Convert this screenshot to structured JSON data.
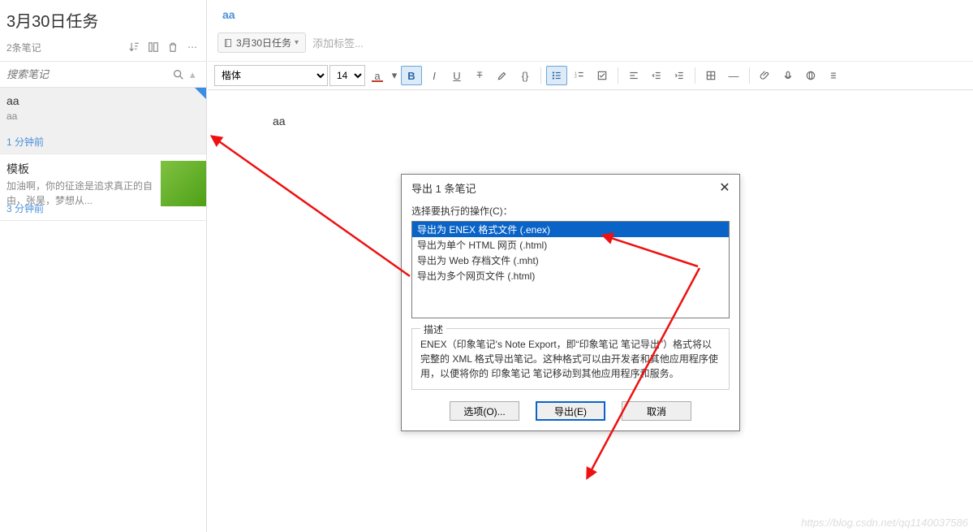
{
  "sidebar": {
    "title": "3月30日任务",
    "count_label": "2条笔记",
    "search_placeholder": "搜索笔记",
    "notes": [
      {
        "title": "aa",
        "preview": "aa",
        "time": "1 分钟前"
      },
      {
        "title": "模板",
        "preview": "加油啊，你的征途是追求真正的自由，张昊，梦想从...",
        "time": "3 分钟前"
      }
    ]
  },
  "main": {
    "title": "aa",
    "notebook_label": "3月30日任务",
    "tag_placeholder": "添加标签...",
    "font_name": "楷体",
    "font_size": "14",
    "body_text": "aa"
  },
  "dialog": {
    "title": "导出 1 条笔记",
    "select_label": "选择要执行的操作(C)：",
    "options": [
      "导出为 ENEX 格式文件 (.enex)",
      "导出为单个 HTML 网页 (.html)",
      "导出为 Web 存档文件 (.mht)",
      "导出为多个网页文件 (.html)"
    ],
    "desc_legend": "描述",
    "desc_text": "ENEX（印象笔记's Note Export，即“印象笔记 笔记导出”）格式将以完整的 XML 格式导出笔记。这种格式可以由开发者和其他应用程序使用，以便将你的 印象笔记 笔记移动到其他应用程序和服务。",
    "options_btn": "选项(O)...",
    "export_btn": "导出(E)",
    "cancel_btn": "取消"
  },
  "watermark": "https://blog.csdn.net/qq1140037586"
}
